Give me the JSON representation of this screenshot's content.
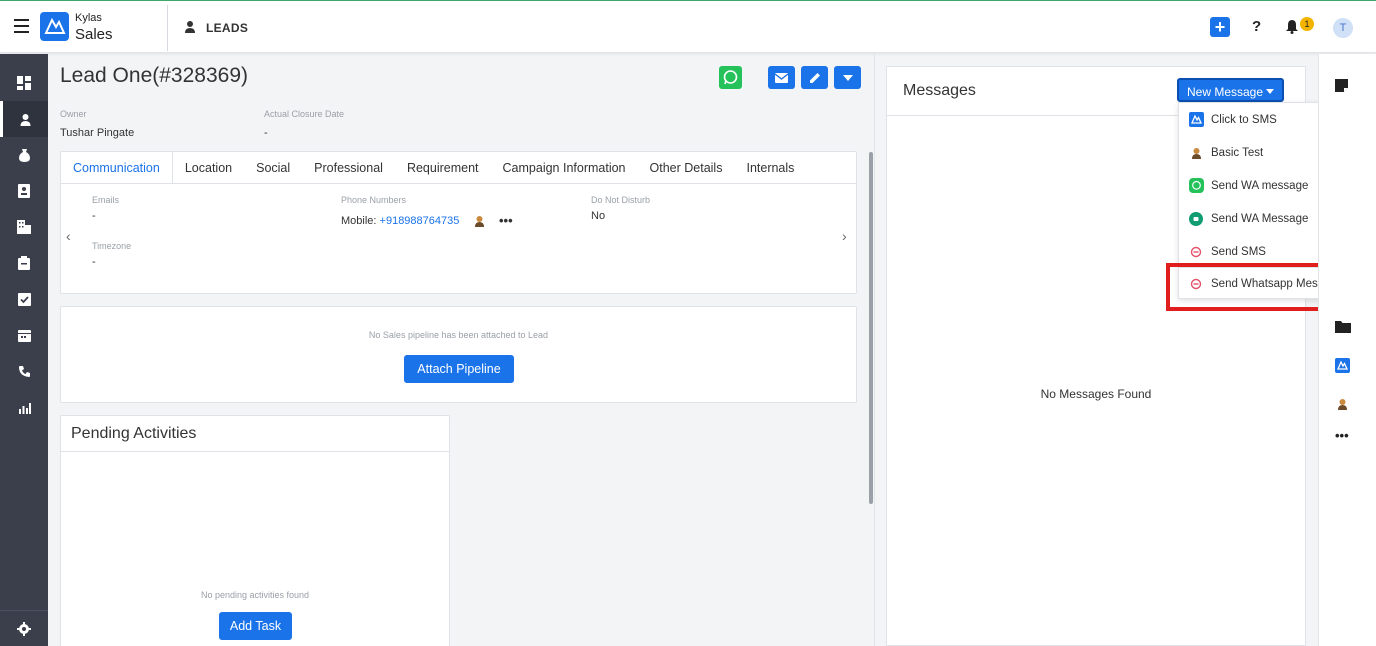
{
  "header": {
    "brand_small": "Kylas",
    "brand_large": "Sales",
    "module_title": "LEADS",
    "notification_count": "1",
    "avatar_initial": "T",
    "help_label": "?"
  },
  "lead": {
    "title": "Lead One(#328369)",
    "owner_label": "Owner",
    "owner_value": "Tushar Pingate",
    "closure_label": "Actual Closure Date",
    "closure_value": "-"
  },
  "tabs": [
    {
      "label": "Communication",
      "active": true
    },
    {
      "label": "Location"
    },
    {
      "label": "Social"
    },
    {
      "label": "Professional"
    },
    {
      "label": "Requirement"
    },
    {
      "label": "Campaign Information"
    },
    {
      "label": "Other Details"
    },
    {
      "label": "Internals"
    }
  ],
  "communication": {
    "emails_label": "Emails",
    "emails_value": "-",
    "phones_label": "Phone Numbers",
    "phone_prefix": "Mobile:",
    "phone_value": "+918988764735",
    "dnd_label": "Do Not Disturb",
    "dnd_value": "No",
    "timezone_label": "Timezone",
    "timezone_value": "-"
  },
  "pipeline": {
    "empty_text": "No Sales pipeline has been attached to Lead",
    "button": "Attach Pipeline"
  },
  "activities": {
    "title": "Pending Activities",
    "empty_text": "No pending activities found",
    "button": "Add Task"
  },
  "messages": {
    "title": "Messages",
    "new_button": "New Message",
    "empty_text": "No Messages Found",
    "menu": [
      {
        "label": "Click to SMS",
        "icon": "kylas-logo-icon"
      },
      {
        "label": "Basic Test",
        "icon": "app-avatar-icon"
      },
      {
        "label": "Send WA message",
        "icon": "whatsapp-icon"
      },
      {
        "label": "Send WA Message",
        "icon": "teal-app-icon"
      },
      {
        "label": "Send SMS",
        "icon": "red-ring-icon"
      },
      {
        "label": "Send Whatsapp Message",
        "icon": "red-ring-icon",
        "highlighted": true
      }
    ]
  },
  "colors": {
    "accent": "#1a73e8",
    "sidebar": "#3a3f4b",
    "whatsapp": "#25c25b",
    "highlight": "#e01e1e",
    "badge": "#f3b400"
  }
}
